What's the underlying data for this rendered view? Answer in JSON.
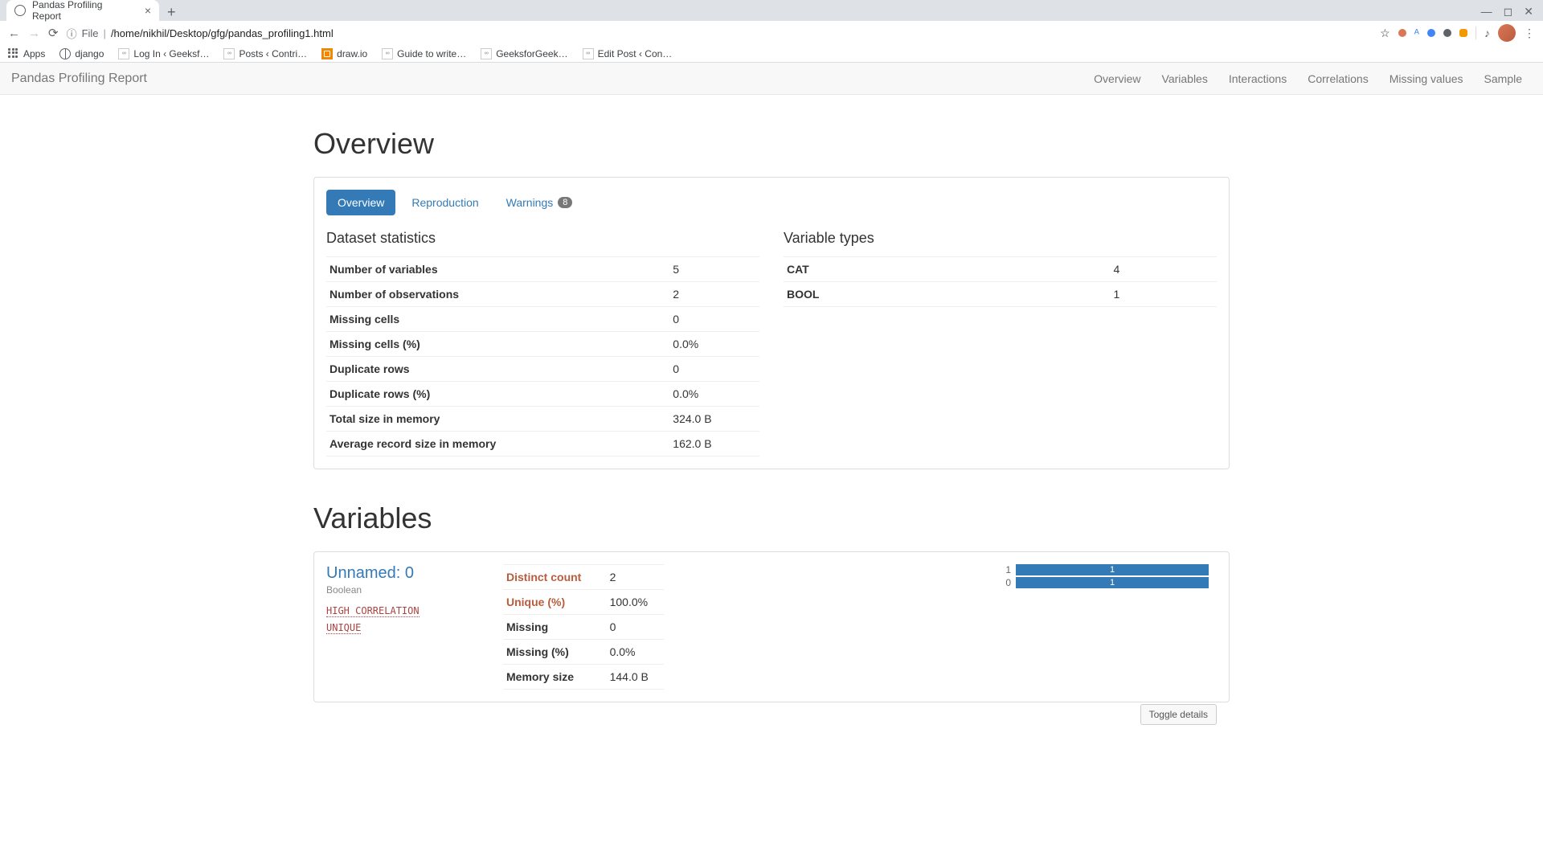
{
  "browser": {
    "tab_title": "Pandas Profiling Report",
    "url_prefix": "File",
    "url_path": "/home/nikhil/Desktop/gfg/pandas_profiling1.html",
    "bookmarks": [
      "Apps",
      "django",
      "Log In ‹ Geeksf…",
      "Posts ‹ Contri…",
      "draw.io",
      "Guide to write…",
      "GeeksforGeek…",
      "Edit Post ‹ Con…"
    ]
  },
  "navbar": {
    "brand": "Pandas Profiling Report",
    "links": [
      "Overview",
      "Variables",
      "Interactions",
      "Correlations",
      "Missing values",
      "Sample"
    ]
  },
  "overview": {
    "title": "Overview",
    "tabs": {
      "overview": "Overview",
      "reproduction": "Reproduction",
      "warnings": "Warnings",
      "warnings_count": "8"
    },
    "dataset_stats_title": "Dataset statistics",
    "dataset_stats": [
      {
        "label": "Number of variables",
        "value": "5"
      },
      {
        "label": "Number of observations",
        "value": "2"
      },
      {
        "label": "Missing cells",
        "value": "0"
      },
      {
        "label": "Missing cells (%)",
        "value": "0.0%"
      },
      {
        "label": "Duplicate rows",
        "value": "0"
      },
      {
        "label": "Duplicate rows (%)",
        "value": "0.0%"
      },
      {
        "label": "Total size in memory",
        "value": "324.0 B"
      },
      {
        "label": "Average record size in memory",
        "value": "162.0 B"
      }
    ],
    "variable_types_title": "Variable types",
    "variable_types": [
      {
        "label": "CAT",
        "value": "4"
      },
      {
        "label": "BOOL",
        "value": "1"
      }
    ]
  },
  "variables": {
    "title": "Variables",
    "var1": {
      "name": "Unnamed: 0",
      "type": "Boolean",
      "tags": [
        "HIGH CORRELATION",
        "UNIQUE"
      ],
      "stats_highlight": [
        {
          "label": "Distinct count",
          "value": "2"
        },
        {
          "label": "Unique (%)",
          "value": "100.0%"
        }
      ],
      "stats_neutral": [
        {
          "label": "Missing",
          "value": "0"
        },
        {
          "label": "Missing (%)",
          "value": "0.0%"
        },
        {
          "label": "Memory size",
          "value": "144.0 B"
        }
      ],
      "chart": [
        {
          "label": "1",
          "value": "1"
        },
        {
          "label": "0",
          "value": "1"
        }
      ],
      "toggle": "Toggle details"
    }
  }
}
